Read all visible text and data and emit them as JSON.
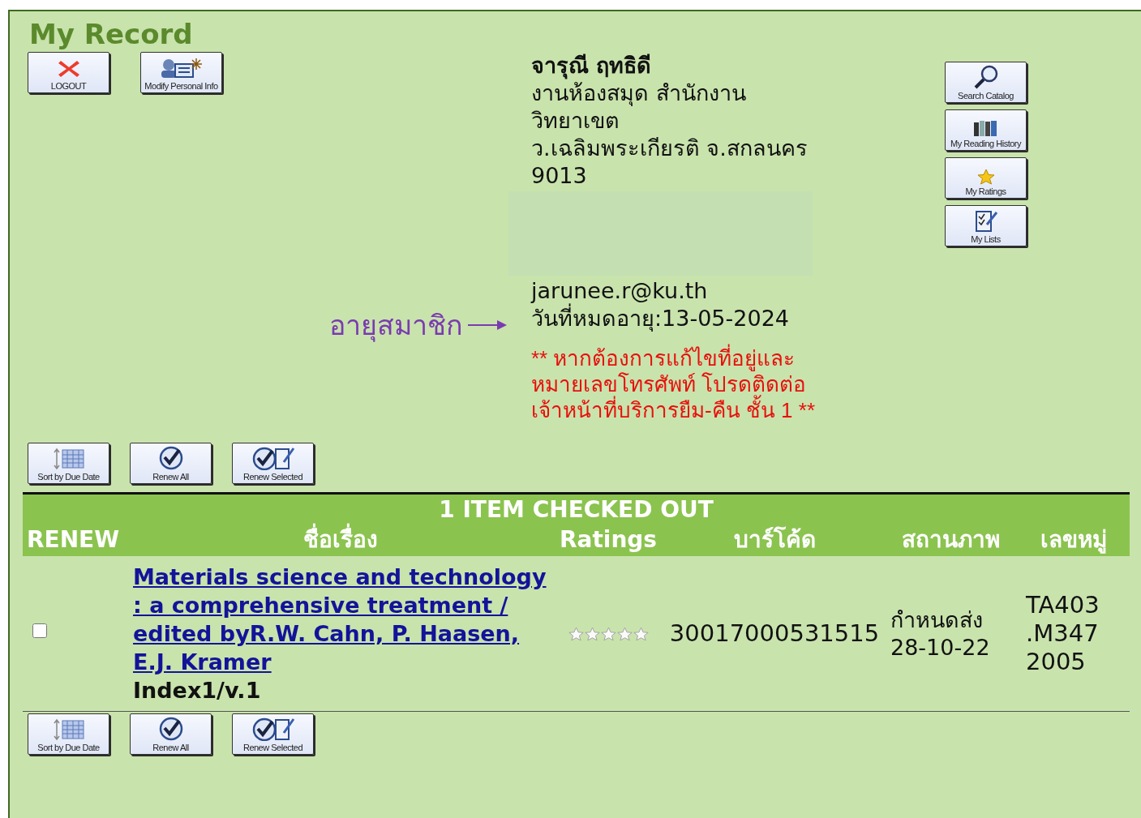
{
  "page": {
    "title": "My Record"
  },
  "top_buttons": [
    {
      "label": "LOGOUT",
      "kind": "logout"
    },
    {
      "label": "Modify Personal Info",
      "kind": "modify"
    }
  ],
  "side_buttons": [
    {
      "label": "Search Catalog",
      "kind": "search"
    },
    {
      "label": "My Reading History",
      "kind": "history"
    },
    {
      "label": "My Ratings",
      "kind": "ratings"
    },
    {
      "label": "My Lists",
      "kind": "lists"
    }
  ],
  "profile": {
    "name": "จารุณี ฤทธิดี",
    "lines": [
      "งานห้องสมุด สำนักงาน",
      "วิทยาเขต",
      "ว.เฉลิมพระเกียรติ จ.สกลนคร",
      "9013"
    ],
    "email": "jarunee.r@ku.th",
    "expiry": "วันที่หมดอายุ:13-05-2024",
    "notice": "** หากต้องการแก้ไขที่อยู่และหมายเลขโทรศัพท์ โปรดติดต่อเจ้าหน้าที่บริการยืม-คืน ชั้น 1 **"
  },
  "annotation": {
    "text": "อายุสมาชิก"
  },
  "action_buttons_top": [
    {
      "label": "Sort by Due Date",
      "kind": "sort"
    },
    {
      "label": "Renew All",
      "kind": "renew"
    },
    {
      "label": "Renew Selected",
      "kind": "renew_selected"
    }
  ],
  "checkout": {
    "heading": "1 ITEM CHECKED OUT",
    "columns": [
      "RENEW",
      "ชื่อเรื่อง",
      "Ratings",
      "บาร์โค้ด",
      "สถานภาพ",
      "เลขหมู่"
    ],
    "rows": [
      {
        "checked": false,
        "title": "Materials science and technology : a comprehensive treatment / edited byR.W. Cahn, P. Haasen, E.J. Kramer",
        "volume": "Index1/v.1",
        "stars": 0,
        "barcode": "30017000531515",
        "status": "กำหนดส่ง",
        "due": "28-10-22",
        "call_number": [
          "TA403",
          ".M347",
          "2005"
        ]
      }
    ]
  },
  "action_buttons_bottom": [
    {
      "label": "Sort by Due Date",
      "kind": "sort"
    },
    {
      "label": "Renew All",
      "kind": "renew"
    },
    {
      "label": "Renew Selected",
      "kind": "renew_selected"
    }
  ]
}
